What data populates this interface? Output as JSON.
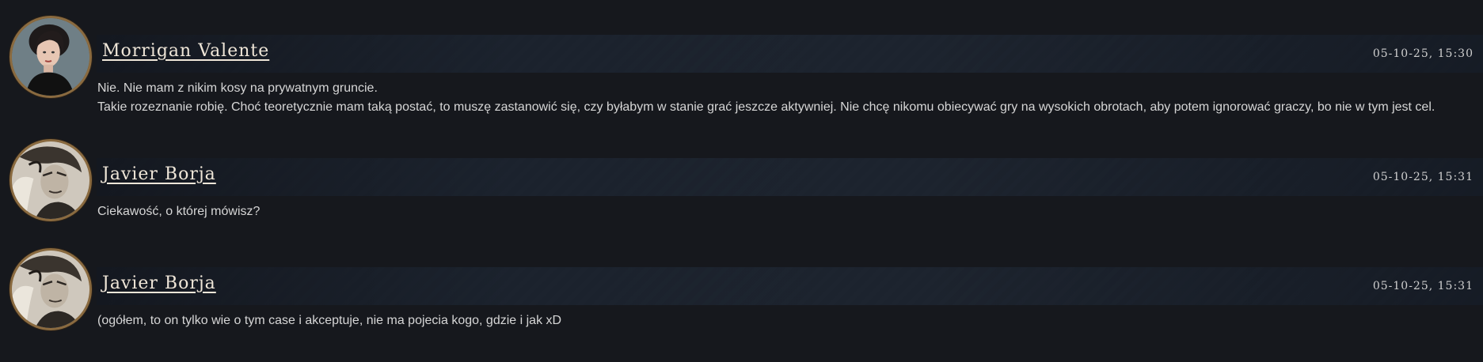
{
  "messages": [
    {
      "author": "Morrigan Valente",
      "timestamp": "05-10-25, 15:30",
      "avatar_icon": "woman-portrait-avatar",
      "lines": [
        "Nie. Nie mam z nikim kosy na prywatnym gruncie.",
        "Takie rozeznanie robię. Choć teoretycznie mam taką postać, to muszę zastanowić się, czy byłabym w stanie grać jeszcze aktywniej. Nie chcę nikomu obiecywać gry na wysokich obrotach, aby potem ignorować graczy, bo nie w tym jest cel."
      ]
    },
    {
      "author": "Javier Borja",
      "timestamp": "05-10-25, 15:31",
      "avatar_icon": "man-portrait-avatar",
      "lines": [
        "Ciekawość, o której mówisz?"
      ]
    },
    {
      "author": "Javier Borja",
      "timestamp": "05-10-25, 15:31",
      "avatar_icon": "man-portrait-avatar",
      "lines": [
        "(ogółem, to on tylko wie o tym case i akceptuje, nie ma pojecia kogo, gdzie i jak xD"
      ]
    }
  ],
  "colors": {
    "background": "#16181d",
    "avatar_ring": "#8a6a3f",
    "name_text": "#efe6d8"
  }
}
